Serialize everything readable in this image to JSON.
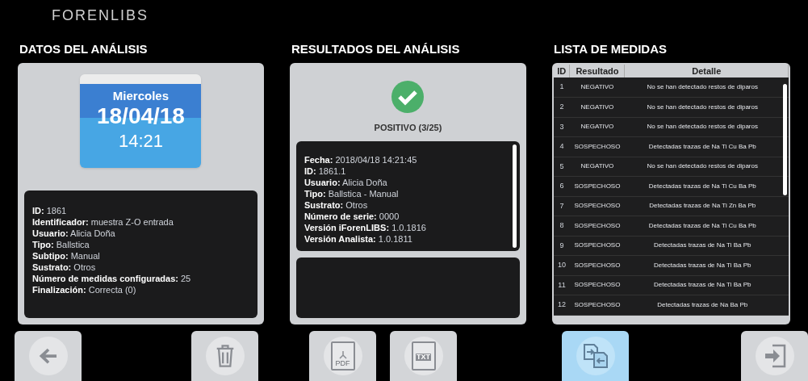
{
  "logo": "FORENLIBS",
  "analysis": {
    "title": "DATOS DEL ANÁLISIS",
    "calendar": {
      "weekday": "Miercoles",
      "date": "18/04/18",
      "time": "14:21"
    },
    "fields": [
      {
        "label": "ID:",
        "value": "1861"
      },
      {
        "label": "Identificador:",
        "value": "muestra Z-O entrada"
      },
      {
        "label": "Usuario:",
        "value": "Alicia Doña"
      },
      {
        "label": "Tipo:",
        "value": "Ballstica"
      },
      {
        "label": "Subtipo:",
        "value": "Manual"
      },
      {
        "label": "Sustrato:",
        "value": "Otros"
      },
      {
        "label": "Número de medidas configuradas:",
        "value": "25"
      },
      {
        "label": "Finalización:",
        "value": "Correcta (0)"
      }
    ]
  },
  "results": {
    "title": "RESULTADOS DEL ANÁLISIS",
    "status": "POSITIVO (3/25)",
    "fields": [
      {
        "label": "Fecha:",
        "value": "2018/04/18 14:21:45"
      },
      {
        "label": "ID:",
        "value": "1861.1"
      },
      {
        "label": "Usuario:",
        "value": "Alicia Doña"
      },
      {
        "label": "Tipo:",
        "value": "Ballstica - Manual"
      },
      {
        "label": "Sustrato:",
        "value": "Otros"
      },
      {
        "label": "Número de serie:",
        "value": "0000"
      },
      {
        "label": "Versión iForenLIBS:",
        "value": "1.0.1816"
      },
      {
        "label": "Versión Analista:",
        "value": "1.0.1811"
      }
    ]
  },
  "measures": {
    "title": "LISTA DE MEDIDAS",
    "columns": [
      "ID",
      "Resultado",
      "Detalle"
    ],
    "rows": [
      {
        "id": "1",
        "result": "NEGATIVO",
        "detail": "No se han detectado restos de diparos"
      },
      {
        "id": "2",
        "result": "NEGATIVO",
        "detail": "No se han detectado restos de diparos"
      },
      {
        "id": "3",
        "result": "NEGATIVO",
        "detail": "No se han detectado restos de diparos"
      },
      {
        "id": "4",
        "result": "SOSPECHOSO",
        "detail": "Detectadas trazas de Na Ti Cu Ba Pb"
      },
      {
        "id": "5",
        "result": "NEGATIVO",
        "detail": "No se han detectado restos de diparos"
      },
      {
        "id": "6",
        "result": "SOSPECHOSO",
        "detail": "Detectadas trazas de Na Ti Cu Ba Pb"
      },
      {
        "id": "7",
        "result": "SOSPECHOSO",
        "detail": "Detectadas trazas de Na Ti Zn Ba Pb"
      },
      {
        "id": "8",
        "result": "SOSPECHOSO",
        "detail": "Detectadas trazas de Na Ti Cu Ba Pb"
      },
      {
        "id": "9",
        "result": "SOSPECHOSO",
        "detail": "Detectadas trazas de Na Ti Ba Pb"
      },
      {
        "id": "10",
        "result": "SOSPECHOSO",
        "detail": "Detectadas trazas de Na Ti Ba Pb"
      },
      {
        "id": "11",
        "result": "SOSPECHOSO",
        "detail": "Detectadas trazas de Na Ti Ba Pb"
      },
      {
        "id": "12",
        "result": "SOSPECHOSO",
        "detail": "Detectadas trazas de Na Ba Pb"
      }
    ]
  },
  "buttons": [
    {
      "kind": "back",
      "selected": false
    },
    {
      "kind": "delete",
      "selected": false
    },
    {
      "kind": "pdf",
      "label": "PDF",
      "selected": false
    },
    {
      "kind": "txt",
      "label": "TXT",
      "selected": false
    },
    {
      "kind": "compare",
      "selected": true
    },
    {
      "kind": "exit",
      "selected": false
    }
  ]
}
